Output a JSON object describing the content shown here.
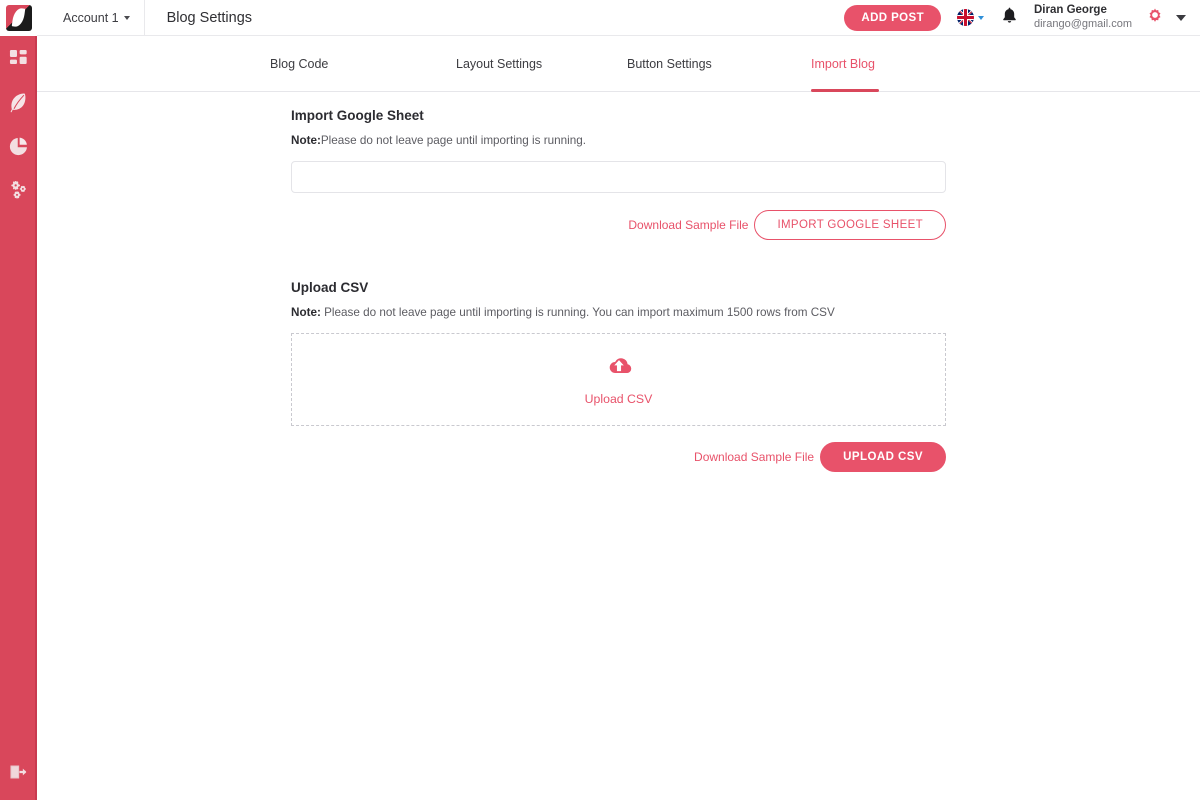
{
  "app": {
    "brand_red": "#e8526a",
    "sidebar_red": "#d9475b",
    "logo_name": "feather-logo"
  },
  "topbar": {
    "account_label": "Account 1",
    "page_title": "Blog Settings",
    "add_post_label": "ADD POST",
    "language_flag": "uk-flag-icon",
    "notification_icon": "bell-icon",
    "user_name": "Diran George",
    "user_email": "dirango@gmail.com",
    "settings_icon": "gear-icon",
    "user_menu_icon": "chevron-down-icon"
  },
  "sidebar": {
    "items": [
      {
        "name": "dashboard",
        "icon": "grid-dashboard-icon"
      },
      {
        "name": "blog",
        "icon": "feather-icon"
      },
      {
        "name": "analytics",
        "icon": "pie-chart-icon"
      },
      {
        "name": "integrations",
        "icon": "gears-icon"
      }
    ],
    "bottom": {
      "name": "logout",
      "icon": "logout-icon"
    }
  },
  "tabs": [
    {
      "label": "Blog Code",
      "active": false
    },
    {
      "label": "Layout Settings",
      "active": false
    },
    {
      "label": "Button Settings",
      "active": false
    },
    {
      "label": "Import Blog",
      "active": true
    }
  ],
  "google_sheet": {
    "title": "Import Google Sheet",
    "note_label": "Note:",
    "note_text": "Please do not leave page until importing is running.",
    "input_value": "",
    "input_placeholder": "",
    "download_sample_label": "Download Sample File",
    "import_button_label": "IMPORT GOOGLE SHEET"
  },
  "upload_csv": {
    "title": "Upload CSV",
    "note_label": "Note:",
    "note_text": " Please do not leave page until importing is running. You can import maximum 1500 rows from CSV",
    "dropzone_label": "Upload CSV",
    "dropzone_icon": "cloud-upload-icon",
    "download_sample_label": "Download Sample File",
    "upload_button_label": "UPLOAD CSV"
  }
}
